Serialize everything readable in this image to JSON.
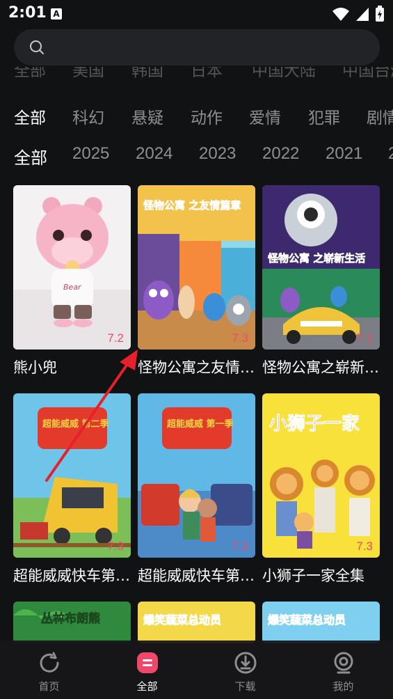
{
  "status": {
    "time": "2:01",
    "badge": "A"
  },
  "search": {
    "placeholder": ""
  },
  "filters": {
    "partial_row": [
      "全部",
      "美国",
      "韩国",
      "日本",
      "中国大陆",
      "中国台湾"
    ],
    "genres": [
      "全部",
      "科幻",
      "悬疑",
      "动作",
      "爱情",
      "犯罪",
      "剧情"
    ],
    "years": [
      "全部",
      "2025",
      "2024",
      "2023",
      "2022",
      "2021",
      "2"
    ]
  },
  "cards": [
    {
      "title": "熊小兜",
      "score": "7.2"
    },
    {
      "title": "怪物公寓之友情篇章",
      "score": "7.3"
    },
    {
      "title": "怪物公寓之崭新生活",
      "score": "7.1"
    },
    {
      "title": "超能威威快车第二季",
      "score": "7.3"
    },
    {
      "title": "超能威威快车第一季",
      "score": "7.3"
    },
    {
      "title": "小狮子一家全集",
      "score": "7.3"
    },
    {
      "title": "丛林布朗熊",
      "score": ""
    },
    {
      "title": "爆笑蔬菜总动员",
      "score": ""
    },
    {
      "title": "爆笑蔬菜总动员",
      "score": ""
    }
  ],
  "poster_text": {
    "bear_shirt": "Bear",
    "monster1": "怪物公寓 之友情篇章",
    "monster2": "怪物公寓 之崭新生活",
    "train_s2": "超能威威 第二季",
    "train_s1": "超能威威 第一季",
    "lion": "小狮子一家",
    "jungle": "丛林布朗熊",
    "veggie": "爆笑蔬菜总动员"
  },
  "tabs": [
    {
      "label": "首页",
      "icon": "home-icon"
    },
    {
      "label": "全部",
      "icon": "all-icon"
    },
    {
      "label": "下载",
      "icon": "download-icon"
    },
    {
      "label": "我的",
      "icon": "profile-icon"
    }
  ],
  "colors": {
    "accent": "#f0486a",
    "background": "#111214",
    "annotation": "#e8202a"
  }
}
